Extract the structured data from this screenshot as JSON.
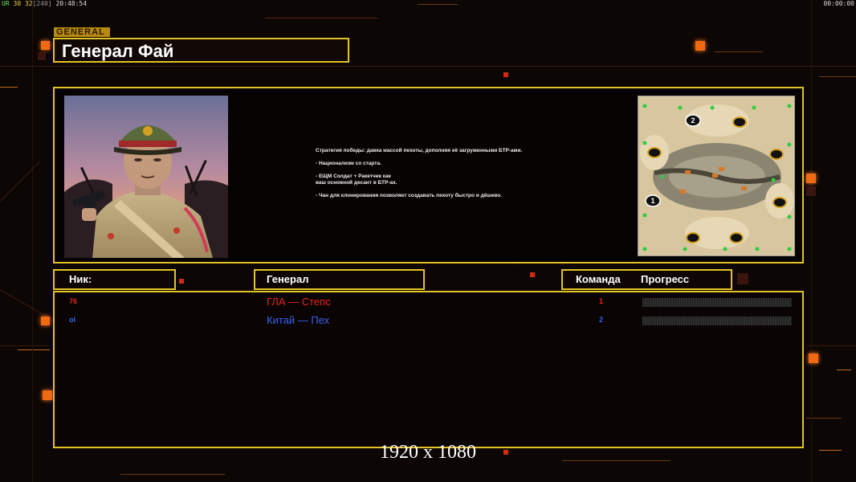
{
  "hud": {
    "fps_label": "UR",
    "fps_value": "30",
    "frame_value": "32",
    "frame_total": "[240]",
    "clock": "20:48:54",
    "timer": "00:00:00"
  },
  "general_tag": "GENERAL",
  "title": "Генерал Фай",
  "description": [
    "Стратегия победы: давка массой пехоты, дополняя её загруженными БТР-ами.",
    "- Национализм со старта.",
    "- ЕЩМ Солдат + Ракетчик как\nваш основной десант в БТР-ах.",
    "- Чан для клонирования позволяет создавать пехоту быстро и дёшево."
  ],
  "minimap": {
    "start_positions": [
      "1",
      "2"
    ]
  },
  "headers": {
    "nick": "Ник:",
    "general": "Генерал",
    "team": "Команда",
    "progress": "Прогресс"
  },
  "players": [
    {
      "nick": "76",
      "general": "ГЛА — Степс",
      "team": "1",
      "color": "#e8261c",
      "progress": 0
    },
    {
      "nick": "ol",
      "general": "Китай — Пех",
      "team": "2",
      "color": "#3a62ee",
      "progress": 0
    }
  ],
  "resolution": "1920 x 1080",
  "colors": {
    "accent": "#e3c228",
    "glow": "#f06a12"
  }
}
